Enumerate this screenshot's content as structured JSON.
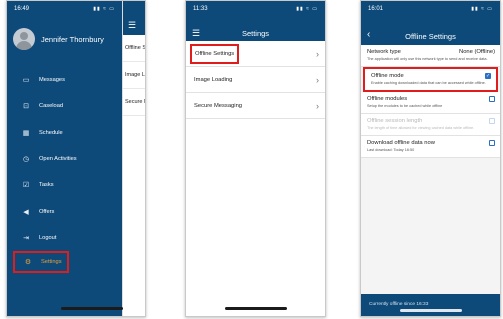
{
  "phone1": {
    "status": {
      "time": "16:49",
      "icons": "▮▮ ≈ ▭"
    },
    "user_name": "Jennifer Thornbury",
    "menu": [
      {
        "icon": "chat-icon",
        "glyph": "▭",
        "label": "Messages"
      },
      {
        "icon": "caseload-icon",
        "glyph": "⊡",
        "label": "Caseload"
      },
      {
        "icon": "calendar-icon",
        "glyph": "▦",
        "label": "Schedule"
      },
      {
        "icon": "clock-icon",
        "glyph": "◷",
        "label": "Open Activities"
      },
      {
        "icon": "tasks-icon",
        "glyph": "☑",
        "label": "Tasks"
      },
      {
        "icon": "megaphone-icon",
        "glyph": "◀",
        "label": "Offers"
      },
      {
        "icon": "logout-icon",
        "glyph": "⇥",
        "label": "Logout"
      },
      {
        "icon": "gear-icon",
        "glyph": "⚙",
        "label": "Settings"
      }
    ],
    "behind_rows": [
      "Offline S",
      "Image Lo",
      "Secure M"
    ]
  },
  "phone2": {
    "status": {
      "time": "11:33",
      "icons": "▮▮ ≈ ▭"
    },
    "title": "Settings",
    "rows": [
      {
        "label": "Offline Settings",
        "selected": true
      },
      {
        "label": "Image Loading",
        "selected": false
      },
      {
        "label": "Secure Messaging",
        "selected": false
      }
    ]
  },
  "phone3": {
    "status": {
      "time": "16:01",
      "icons": "▮▮ ≈ ▭"
    },
    "title": "Offline Settings",
    "network": {
      "label": "Network type",
      "value": "None (Offline)",
      "desc": "The application will only use this network type to send and receive data."
    },
    "offline_mode": {
      "label": "Offline mode",
      "checked": true,
      "desc": "Enable caching downloaded data that can be accessed while offline."
    },
    "offline_modules": {
      "label": "Offline modules",
      "checked": false,
      "desc": "Setup the modules to be cached while offline"
    },
    "session_length": {
      "label": "Offline session length",
      "checked": false,
      "desc": "The length of time allowed for viewing cached data while offline."
    },
    "download": {
      "label": "Download offline data now",
      "checked": false,
      "desc": "Last download: Today 16:50"
    },
    "footer": "Currently offline since 16:33"
  },
  "colors": {
    "brand": "#0d4a7a",
    "highlight": "#e01d1d",
    "accent": "#e8a03a",
    "checkbox": "#2a6fc2"
  }
}
